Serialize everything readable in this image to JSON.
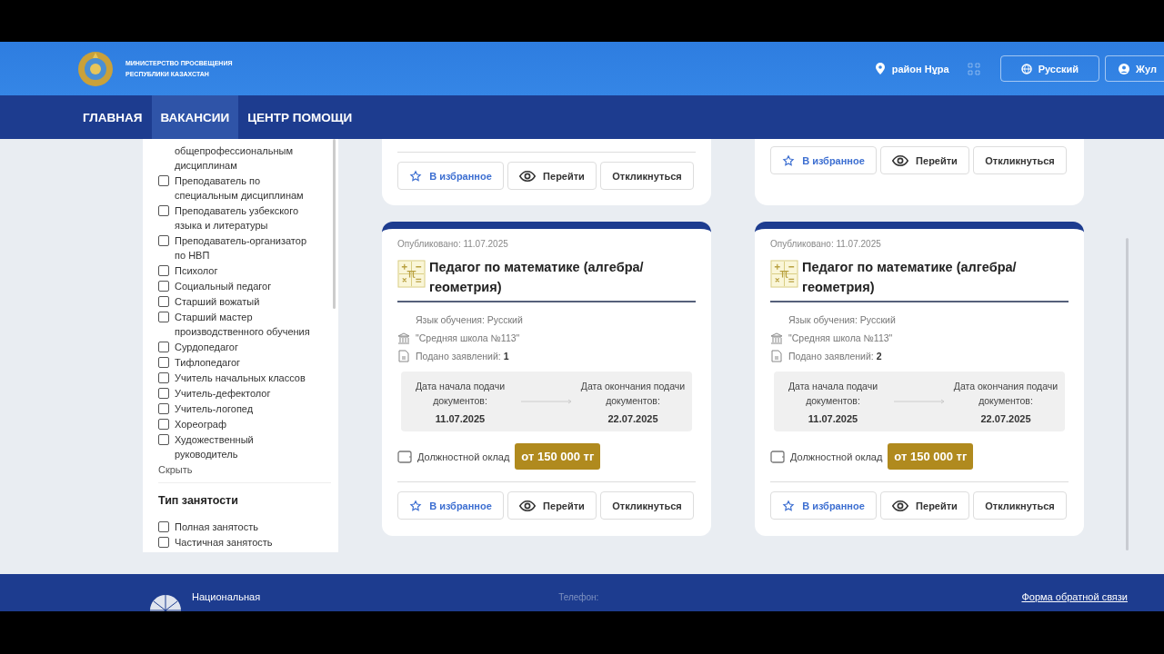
{
  "header": {
    "ministry": [
      "МИНИСТЕРСТВО ПРОСВЕЩЕНИЯ",
      "РЕСПУБЛИКИ КАЗАХСТАН"
    ],
    "location": "район Нұра",
    "language": "Русский",
    "user": "Жул"
  },
  "nav": [
    {
      "label": "ГЛАВНАЯ",
      "selected": false
    },
    {
      "label": "ВАКАНСИИ",
      "selected": true
    },
    {
      "label": "ЦЕНТР ПОМОЩИ",
      "selected": false
    }
  ],
  "sidebar": {
    "positions": [
      {
        "kind": "continuation",
        "label": "общепрофессиональным дисциплинам"
      },
      {
        "kind": "checkbox",
        "label": "Преподаватель по специальным дисциплинам",
        "checked": false
      },
      {
        "kind": "checkbox",
        "label": "Преподаватель узбекского языка и литературы",
        "checked": false
      },
      {
        "kind": "checkbox",
        "label": "Преподаватель-организатор по НВП",
        "checked": false
      },
      {
        "kind": "checkbox",
        "label": "Психолог",
        "checked": false
      },
      {
        "kind": "checkbox",
        "label": "Социальный педагог",
        "checked": false
      },
      {
        "kind": "checkbox",
        "label": "Старший вожатый",
        "checked": false
      },
      {
        "kind": "checkbox",
        "label": "Старший мастер производственного обучения",
        "checked": false
      },
      {
        "kind": "checkbox",
        "label": "Сурдопедагог",
        "checked": false
      },
      {
        "kind": "checkbox",
        "label": "Тифлопедагог",
        "checked": false
      },
      {
        "kind": "checkbox",
        "label": "Учитель начальных классов",
        "checked": false
      },
      {
        "kind": "checkbox",
        "label": "Учитель-дефектолог",
        "checked": false
      },
      {
        "kind": "checkbox",
        "label": "Учитель-логопед",
        "checked": false
      },
      {
        "kind": "checkbox",
        "label": "Хореограф",
        "checked": false
      },
      {
        "kind": "checkbox",
        "label": "Художественный руководитель",
        "checked": false
      }
    ],
    "hide_link": "Скрыть",
    "employment_title": "Тип занятости",
    "employment": [
      {
        "label": "Полная занятость",
        "checked": false
      },
      {
        "label": "Частичная занятость",
        "checked": false
      }
    ]
  },
  "columns": [
    {
      "top_buttons": [
        "В избранное",
        "Перейти",
        "Откликнуться"
      ],
      "card": {
        "published": "Опубликовано: 11.07.2025",
        "title": "Педагог по математике (алгебра/ геометрия)",
        "language": "Язык обучения: Русский",
        "school": "\"Средняя школа №113\"",
        "applications": "Подано заявлений: **1**",
        "start_label": "Дата начала подачи документов:",
        "start_date": "11.07.2025",
        "end_label": "Дата окончания подачи документов:",
        "end_date": "22.07.2025",
        "salary_label": "Должностной оклад",
        "salary": "от 150 000 тг",
        "buttons": [
          "В избранное",
          "Перейти",
          "Откликнуться"
        ]
      }
    },
    {
      "top_buttons": [
        "В избранное",
        "Перейти",
        "Откликнуться"
      ],
      "card": {
        "published": "Опубликовано: 11.07.2025",
        "title": "Педагог по математике (алгебра/ геометрия)",
        "language": "Язык обучения: Русский",
        "school": "\"Средняя школа №113\"",
        "applications": "Подано заявлений: **2**",
        "start_label": "Дата начала подачи документов:",
        "start_date": "11.07.2025",
        "end_label": "Дата окончания подачи документов:",
        "end_date": "22.07.2025",
        "salary_label": "Должностной оклад",
        "salary": "от 150 000 тг",
        "buttons": [
          "В избранное",
          "Перейти",
          "Откликнуться"
        ]
      }
    }
  ],
  "footer": {
    "org": "Национальная",
    "phone_label": "Телефон:",
    "feedback_link": "Форма обратной связи"
  }
}
